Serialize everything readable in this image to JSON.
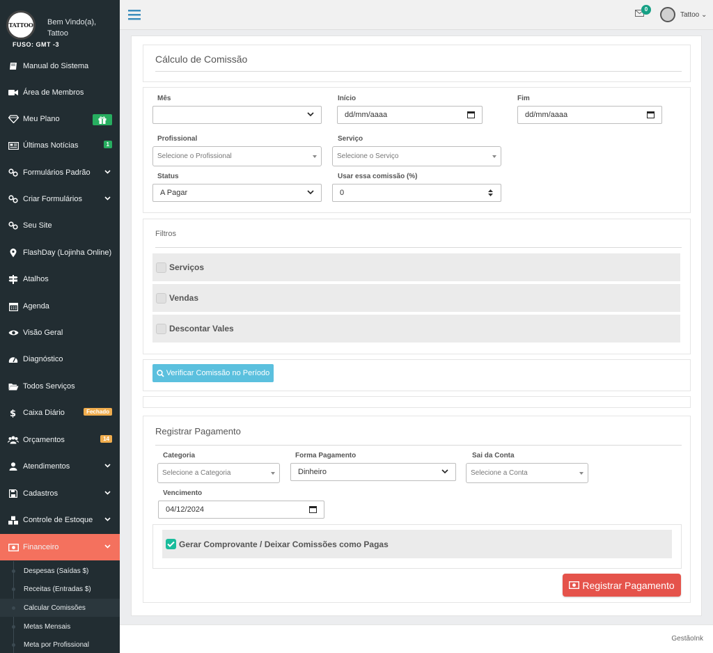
{
  "sidebar": {
    "logo_text": "TATTOO",
    "welcome_line1": "Bem Vindo(a),",
    "welcome_line2": "Tattoo",
    "timezone": "FUSO: GMT -3",
    "items": [
      {
        "label": "Manual do Sistema",
        "icon": "book-icon"
      },
      {
        "label": "Área de Membros",
        "icon": "video-camera-icon"
      },
      {
        "label": "Meu Plano",
        "icon": "diamond-icon",
        "badge_icon": "gift-icon",
        "badge_color": "#27ae60"
      },
      {
        "label": "Últimas Notícias",
        "icon": "newspaper-icon",
        "badge": "1",
        "badge_color": "#27ae60"
      },
      {
        "label": "Formulários Padrão",
        "icon": "link-icon",
        "chevron": true
      },
      {
        "label": "Criar Formulários",
        "icon": "link-icon",
        "chevron": true
      },
      {
        "label": "Seu Site",
        "icon": "link-icon"
      },
      {
        "label": "FlashDay (Lojinha Online)",
        "icon": "map-marker-icon"
      },
      {
        "label": "Atalhos",
        "icon": "signpost-icon"
      },
      {
        "label": "Agenda",
        "icon": "calendar-icon"
      },
      {
        "label": "Visão Geral",
        "icon": "eye-icon"
      },
      {
        "label": "Diagnóstico",
        "icon": "dashboard-icon"
      },
      {
        "label": "Todos Serviços",
        "icon": "folder-open-icon"
      },
      {
        "label": "Caixa Diário",
        "icon": "dollar-icon",
        "badge": "Fechado",
        "badge_color": "#f0ad4e"
      },
      {
        "label": "Orçamentos",
        "icon": "users-icon",
        "badge": "14",
        "badge_color": "#f0ad4e"
      },
      {
        "label": "Atendimentos",
        "icon": "user-icon",
        "chevron": true
      },
      {
        "label": "Cadastros",
        "icon": "save-icon",
        "chevron": true
      },
      {
        "label": "Controle de Estoque",
        "icon": "cubes-icon",
        "chevron": true
      },
      {
        "label": "Financeiro",
        "icon": "money-icon",
        "chevron": true,
        "active": true
      }
    ],
    "subitems": [
      {
        "label": "Despesas (Saídas $)"
      },
      {
        "label": "Receitas (Entradas $)"
      },
      {
        "label": "Calcular Comissões",
        "current": true
      },
      {
        "label": "Metas Mensais"
      },
      {
        "label": "Meta por Profissional"
      }
    ]
  },
  "topbar": {
    "mail_count": "0",
    "user_name": "Tattoo"
  },
  "calc": {
    "title": "Cálculo de Comissão",
    "mes_label": "Mês",
    "mes_value": "",
    "inicio_label": "Início",
    "inicio_value": "dd/mm/aaaa",
    "fim_label": "Fim",
    "fim_value": "dd/mm/aaaa",
    "profissional_label": "Profissional",
    "profissional_placeholder": "Selecione o Profissional",
    "servico_label": "Serviço",
    "servico_placeholder": "Selecione o Serviço",
    "status_label": "Status",
    "status_value": "A Pagar",
    "comissao_label": "Usar essa comissão (%)",
    "comissao_value": "0"
  },
  "filters": {
    "title": "Filtros",
    "options": [
      "Serviços",
      "Vendas",
      "Descontar Vales"
    ]
  },
  "verify_button": "Verificar Comissão no Período",
  "payment": {
    "title": "Registrar Pagamento",
    "categoria_label": "Categoria",
    "categoria_placeholder": "Selecione a Categoria",
    "forma_label": "Forma Pagamento",
    "forma_value": "Dinheiro",
    "conta_label": "Sai da Conta",
    "conta_placeholder": "Selecione a Conta",
    "vencimento_label": "Vencimento",
    "vencimento_value": "04/12/2024",
    "gerar_label": "Gerar Comprovante / Deixar Comissões como Pagas",
    "gerar_checked": true,
    "submit_label": "Registrar Pagamento"
  },
  "footer": {
    "brand": "GestãoInk"
  }
}
